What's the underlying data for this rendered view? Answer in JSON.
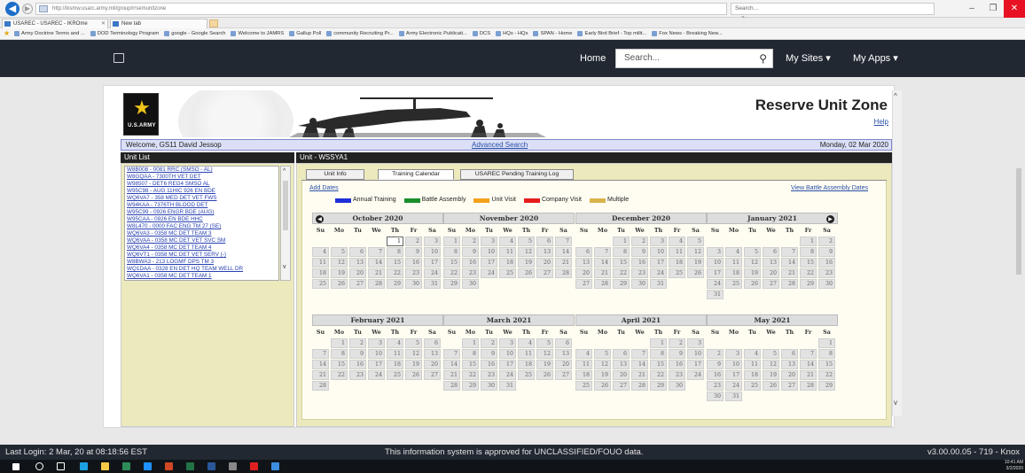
{
  "browser": {
    "url": "http://iksmw.usarc.army.mil/group/rrsemunitzone",
    "search_placeholder": "Search...",
    "tabs": [
      {
        "label": "USAREC - USAREC - IKROme"
      },
      {
        "label": "New tab"
      }
    ],
    "favorites": [
      "Army Doctrine Terms and ...",
      "DOD Terminology Program",
      "google - Google Search",
      "Welcome to JAMRS",
      "Gallup Poll",
      "community Recruiting Pr...",
      "Army Electronic Publicati...",
      "DCS",
      "HQs - HQs",
      "SPAN - Home",
      "Early Bird Brief - Top milit...",
      "Fox News - Breaking New..."
    ]
  },
  "nav": {
    "home": "Home",
    "search_placeholder": "Search...",
    "my_sites": "My Sites ▾",
    "my_apps": "My Apps ▾"
  },
  "banner": {
    "logo_text": "U.S.ARMY",
    "title": "Reserve Unit Zone",
    "help": "Help"
  },
  "welcome": {
    "greeting": "Welcome, GS11 David Jessop",
    "advanced_search": "Advanced Search",
    "date": "Monday, 02 Mar 2020"
  },
  "unit_list": {
    "header": "Unit List",
    "items": [
      "W8B008 - 0081 RRC (SMSO - AL)",
      "W8GQAA - 7300TH VET DET",
      "W98507 - DET6 REG4 SMSO AL",
      "W95C98 - AUG 11HIC 926 EN BDE",
      "WQ6VA7 - 358 MED DET VET FWS",
      "W94KAA - 7376TH BLOOD DET",
      "W95C99 - 0926 ENGR BDE (AUG)",
      "W95CAA - 0926 EN BDE HHC",
      "W8L470 - 0000 FAC ENG TM 27 (SE)",
      "WQ6VA3 - 0358 MC DET TEAM 3",
      "WQ6VAA - 0358 MC DET VET SVC SM",
      "WQ6VA4 - 0358 MC DET TEAM 4",
      "WQ6VT1 - 0358 MC DET VET SERV (-)",
      "W8BWA3 - 213 LOGMF DPS TM 3",
      "WQ1DAA - 0328 EN DET HQ TEAM WELL DR",
      "WQ6VA1 - 0358 MC DET TEAM 1"
    ]
  },
  "unit": {
    "header": "Unit - WSSYA1",
    "tabs": [
      {
        "label": "Unit Info"
      },
      {
        "label": "Training Calendar"
      },
      {
        "label": "USAREC Pending Training Log"
      }
    ],
    "add_dates": "Add Dates",
    "view_ba": "View Battle Assembly Dates",
    "legend": [
      {
        "label": "Annual Training",
        "color": "#1f2fd8"
      },
      {
        "label": "Battle Assembly",
        "color": "#1a8f2a"
      },
      {
        "label": "Unit Visit",
        "color": "#f2a21a"
      },
      {
        "label": "Company Visit",
        "color": "#e51d1d"
      },
      {
        "label": "Multiple",
        "color": "#d9b44a"
      }
    ]
  },
  "calendar": {
    "dow": [
      "Su",
      "Mo",
      "Tu",
      "We",
      "Th",
      "Fr",
      "Sa"
    ],
    "today": "October 2020-1",
    "months": [
      {
        "name": "October 2020",
        "start": 4,
        "days": 31
      },
      {
        "name": "November 2020",
        "start": 0,
        "days": 30
      },
      {
        "name": "December 2020",
        "start": 2,
        "days": 31
      },
      {
        "name": "January 2021",
        "start": 5,
        "days": 31
      },
      {
        "name": "February 2021",
        "start": 1,
        "days": 28
      },
      {
        "name": "March 2021",
        "start": 1,
        "days": 31
      },
      {
        "name": "April 2021",
        "start": 4,
        "days": 30
      },
      {
        "name": "May 2021",
        "start": 6,
        "days": 31
      }
    ]
  },
  "status": {
    "last_login": "Last Login: 2 Mar, 20 at 08:18:56 EST",
    "classification": "This information system is approved for UNCLASSIFIED/FOUO data.",
    "version": "v3.00.00.05 - 719 - Knox"
  },
  "taskbar": {
    "time": "10:41 AM",
    "date": "3/2/2020"
  }
}
